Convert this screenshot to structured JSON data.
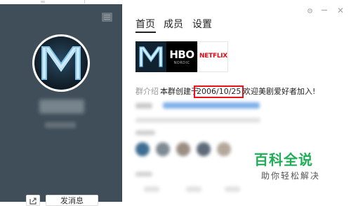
{
  "left_panel": {
    "send_message_label": "发消息"
  },
  "tabs": [
    {
      "label": "首页"
    },
    {
      "label": "成员"
    },
    {
      "label": "设置"
    }
  ],
  "logos": {
    "hbo": "HBO",
    "hbo_sub": "NORDIC",
    "netflix": "NETFLIX"
  },
  "intro": {
    "label": "群介绍",
    "text": "本群创建于",
    "date": "2006/10/25",
    "tail": "欢迎美剧爱好者加入!"
  },
  "watermark": {
    "title": "百科全说",
    "subtitle": "助你轻松解决"
  },
  "colors": {
    "panel_bg": "#3f4e59",
    "highlight_red": "#e8131b",
    "watermark_green": "#1fae57",
    "netflix_red": "#e50914"
  }
}
